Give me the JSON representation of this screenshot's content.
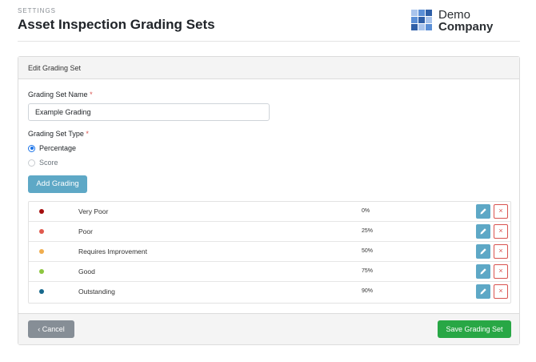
{
  "header": {
    "breadcrumb": "SETTINGS",
    "title": "Asset Inspection Grading Sets"
  },
  "logo": {
    "line1": "Demo",
    "line2": "Company",
    "colors": [
      "#2f5fa7",
      "#5b8fd6",
      "#a9c4ec"
    ]
  },
  "card": {
    "header": "Edit Grading Set",
    "name_label": "Grading Set Name",
    "name_required": "*",
    "name_value": "Example Grading",
    "type_label": "Grading Set Type",
    "type_required": "*",
    "type_options": [
      {
        "label": "Percentage",
        "selected": true
      },
      {
        "label": "Score",
        "selected": false
      }
    ],
    "add_button": "Add Grading",
    "gradings": [
      {
        "name": "Very Poor",
        "value": "0%",
        "color": "#a40d0d"
      },
      {
        "name": "Poor",
        "value": "25%",
        "color": "#e05a4e"
      },
      {
        "name": "Requires Improvement",
        "value": "50%",
        "color": "#f0ad4e"
      },
      {
        "name": "Good",
        "value": "75%",
        "color": "#8cc63f"
      },
      {
        "name": "Outstanding",
        "value": "90%",
        "color": "#17688c"
      }
    ],
    "delete_glyph": "×",
    "cancel_button": "Cancel",
    "save_button": "Save Grading Set"
  },
  "icons": {
    "edit": "pencil-icon",
    "delete": "close-icon",
    "cancel": "chevron-left-icon"
  }
}
